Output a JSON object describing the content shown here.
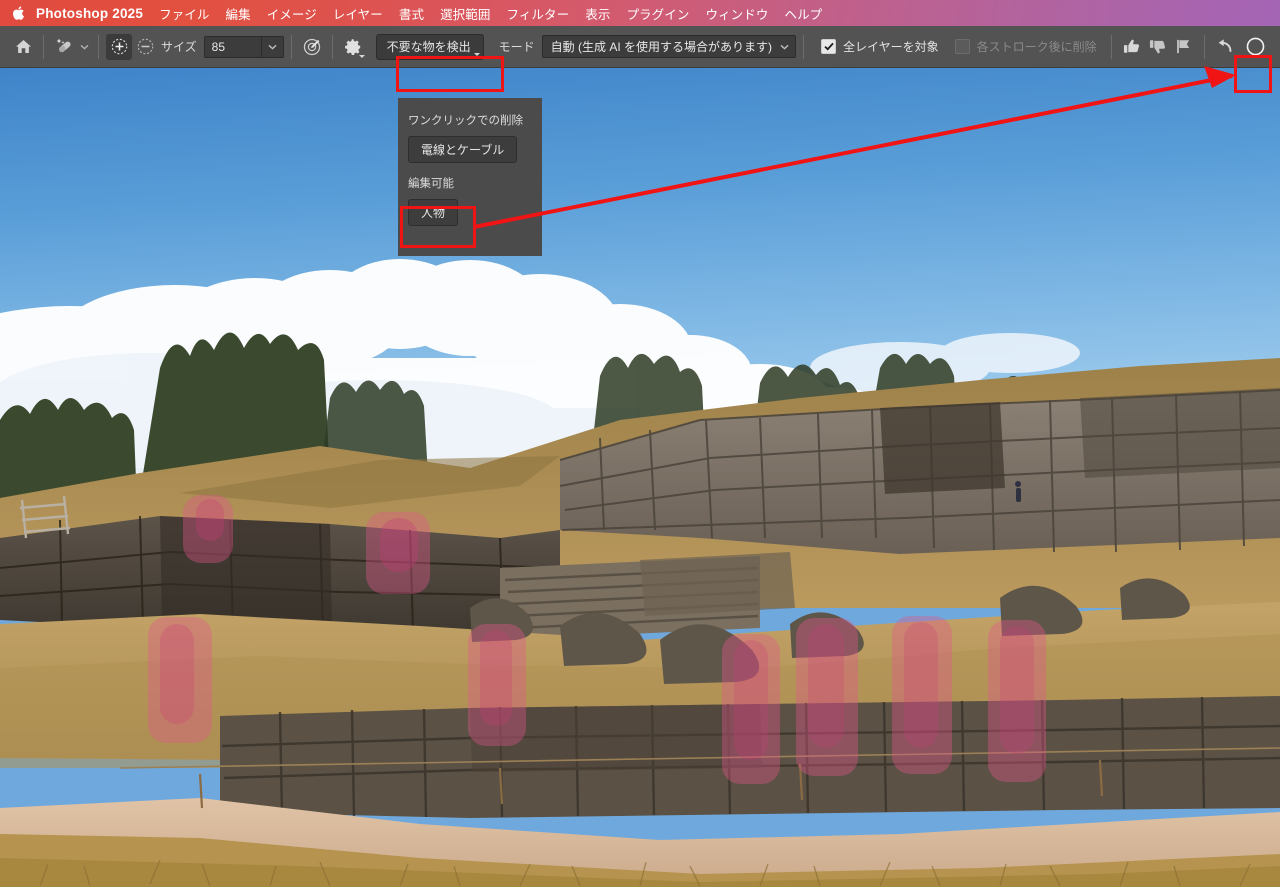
{
  "menubar": {
    "apple_icon": "apple-logo",
    "app_title": "Photoshop 2025",
    "items": [
      "ファイル",
      "編集",
      "イメージ",
      "レイヤー",
      "書式",
      "選択範囲",
      "フィルター",
      "表示",
      "プラグイン",
      "ウィンドウ",
      "ヘルプ"
    ]
  },
  "optionsbar": {
    "home_icon": "home-icon",
    "tool_icon": "remove-tool-icon",
    "tool_chevron": "chevron-down-icon",
    "brush_add_icon": "brush-add-icon",
    "brush_subtract_icon": "brush-subtract-icon",
    "size_label": "サイズ",
    "size_value": "85",
    "size_dropdown_icon": "chevron-down-icon",
    "pressure_icon": "brush-pressure-icon",
    "settings_icon": "gear-icon",
    "detect_button": "不要な物を検出",
    "detect_button_chevron": "chevron-down-icon",
    "mode_label": "モード",
    "mode_value": "自動 (生成 AI を使用する場合があります)",
    "mode_chevron": "chevron-down-icon",
    "sample_all_layers": {
      "label": "全レイヤーを対象",
      "checked": true
    },
    "remove_after_stroke": {
      "label": "各ストローク後に削除",
      "checked": false,
      "disabled": true
    },
    "thumbs_up_icon": "thumbs-up-icon",
    "thumbs_down_icon": "thumbs-down-icon",
    "flag_icon": "flag-icon",
    "reset_icon": "undo-arrow-icon",
    "generate_button_icon": "circle-generate-icon"
  },
  "dropdown": {
    "section_one_click": "ワンクリックでの削除",
    "chip_wires": "電線とケーブル",
    "section_editable": "編集可能",
    "chip_people": "人物"
  },
  "annotations": {
    "highlight_color": "#f01414",
    "boxes": [
      {
        "name": "detect-button-highlight"
      },
      {
        "name": "people-chip-highlight"
      },
      {
        "name": "generate-button-highlight"
      }
    ],
    "arrow": "red-arrow-from-people-chip-to-generate-button"
  },
  "canvas": {
    "description": "サクサイワマン遺跡の写真",
    "selection_overlay_color": "#e2588c",
    "sky_color": "#5e9fd6",
    "stone_color": "#6b6155",
    "grass_color": "#bb9a5e"
  }
}
